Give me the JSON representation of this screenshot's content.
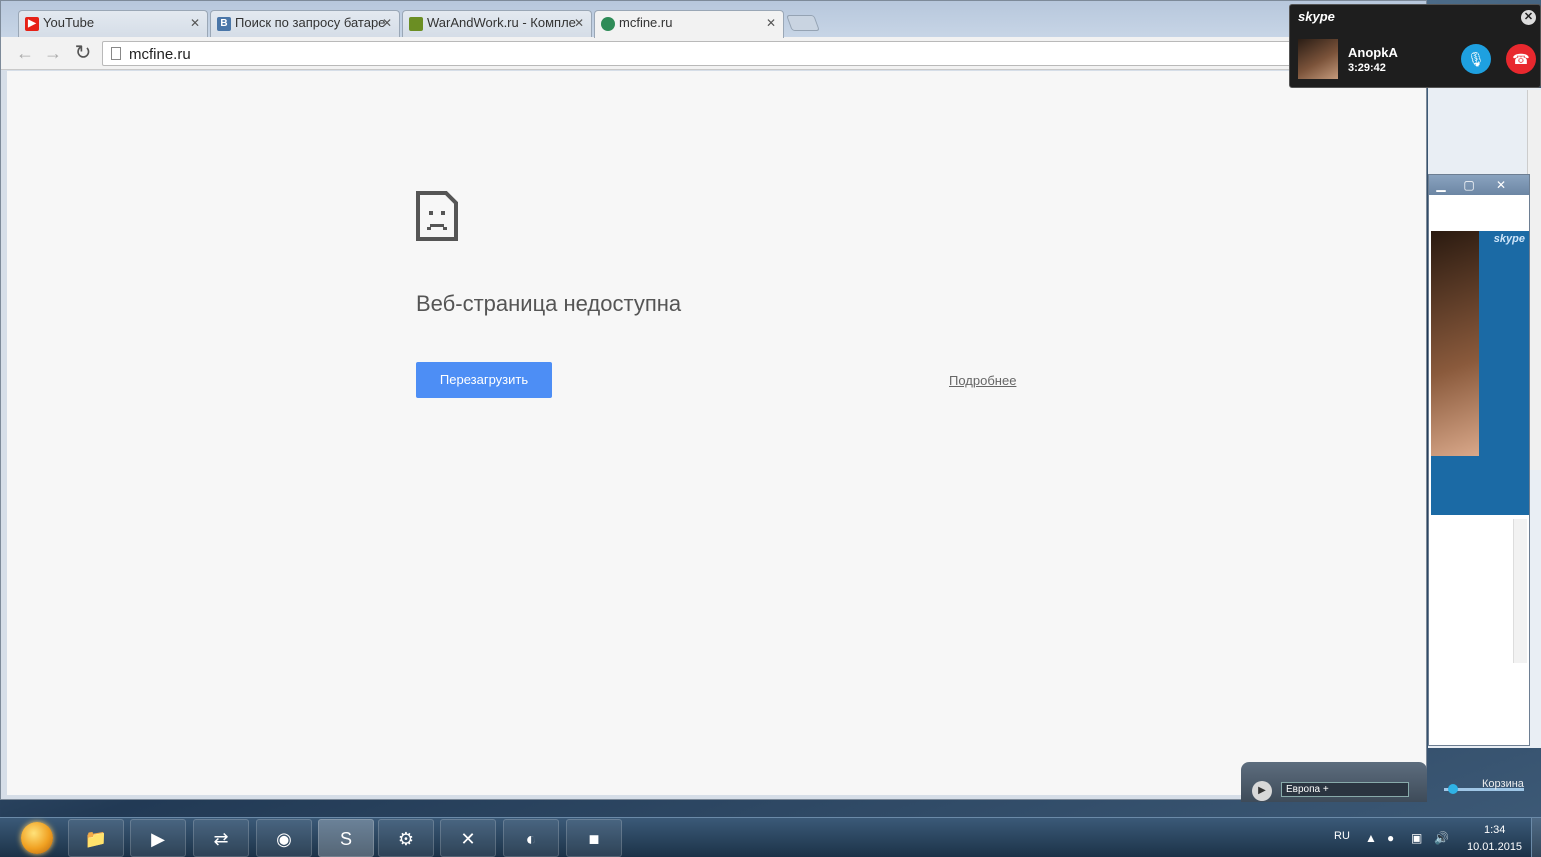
{
  "browser": {
    "tabs": [
      {
        "label": "YouTube",
        "favicon": "youtube-icon",
        "favicon_color": "#e62117",
        "active": false
      },
      {
        "label": "Поиск по запросу батаре",
        "favicon": "vk-icon",
        "favicon_color": "#4a76a8",
        "active": false
      },
      {
        "label": "WarAndWork.ru - Компле",
        "favicon": "minecraft-block-icon",
        "favicon_color": "#6b8e23",
        "active": false
      },
      {
        "label": "mcfine.ru",
        "favicon": "minecraft-globe-icon",
        "favicon_color": "#2e8b57",
        "active": true
      }
    ],
    "address": "mcfine.ru"
  },
  "error_page": {
    "title": "Веб-страница недоступна",
    "reload_label": "Перезагрузить",
    "details_label": "Подробнее",
    "accent": "#4d8ef5"
  },
  "skype_call": {
    "brand": "skype",
    "caller": "AnopkA",
    "duration": "3:29:42"
  },
  "video_window": {
    "brand": "skype"
  },
  "radio": {
    "station": "Европа +"
  },
  "desktop": {
    "recycle_bin": "Корзина"
  },
  "taskbar": {
    "apps": [
      "file-explorer-icon",
      "media-player-icon",
      "teamviewer-icon",
      "chrome-icon",
      "skype-icon",
      "steam-icon",
      "game-icon",
      "audio-icon",
      "minecraft-icon"
    ],
    "lang": "RU",
    "time": "1:34",
    "date": "10.01.2015"
  }
}
